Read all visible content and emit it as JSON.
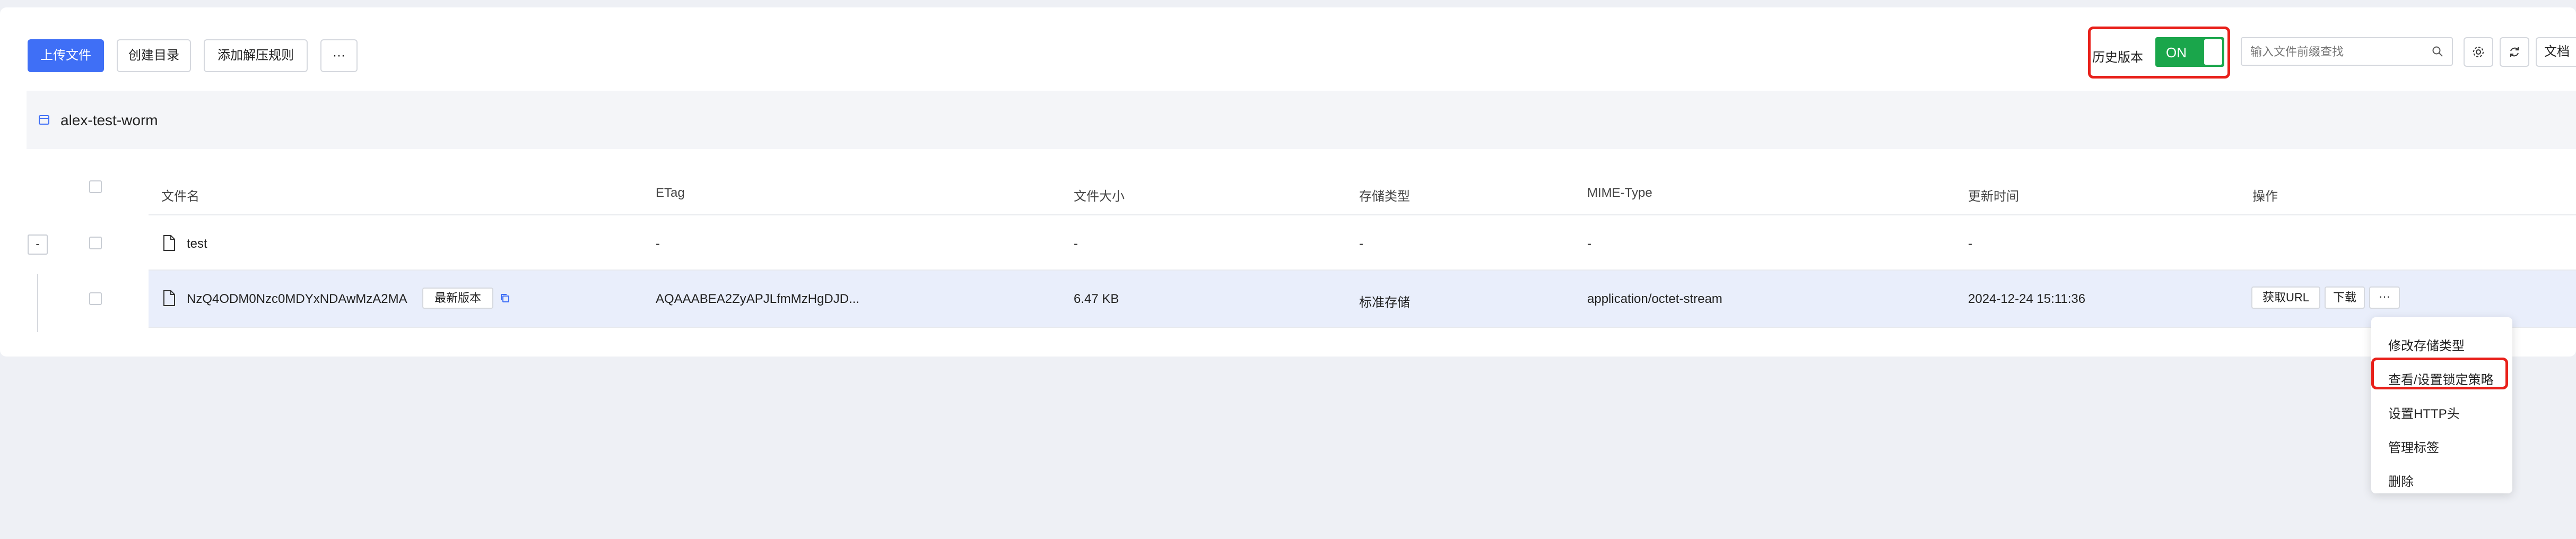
{
  "toolbar": {
    "upload_label": "上传文件",
    "create_dir_label": "创建目录",
    "add_unzip_rule_label": "添加解压规则",
    "more_label": "···",
    "history_version_label": "历史版本",
    "history_toggle_state": "ON",
    "search_placeholder": "输入文件前缀查找",
    "doc_label": "文档"
  },
  "bucket": {
    "name": "alex-test-worm"
  },
  "table": {
    "headers": [
      "文件名",
      "ETag",
      "文件大小",
      "存储类型",
      "MIME-Type",
      "更新时间",
      "操作"
    ],
    "rows": [
      {
        "expander": "-",
        "name": "test",
        "etag": "-",
        "size": "-",
        "storage": "-",
        "mime": "-",
        "updated": "-"
      },
      {
        "name": "NzQ4ODM0Nzc0MDYxNDAwMzA2MA",
        "version_badge": "最新版本",
        "etag": "AQAAABEA2ZyAPJLfmMzHgDJD...",
        "size": "6.47 KB",
        "storage": "标准存储",
        "mime": "application/octet-stream",
        "updated": "2024-12-24 15:11:36",
        "actions": {
          "get_url": "获取URL",
          "download": "下载",
          "more": "···"
        }
      }
    ]
  },
  "dropdown_menu": {
    "items": [
      "修改存储类型",
      "查看/设置锁定策略",
      "设置HTTP头",
      "管理标签",
      "删除"
    ]
  },
  "colors": {
    "primary": "#3f6ff6",
    "toggle_on": "#1aa64b",
    "highlight": "#e8201a",
    "page_bg": "#eef0f5"
  }
}
